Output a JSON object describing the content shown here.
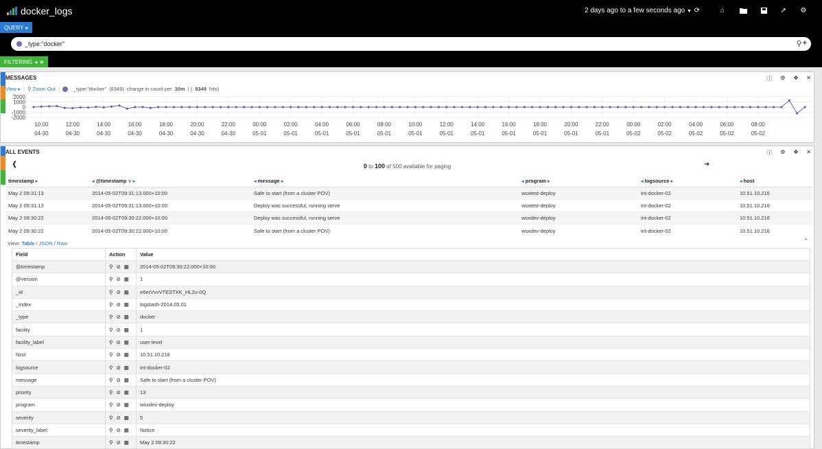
{
  "header": {
    "title": "docker_logs",
    "time_range": "2 days ago to a few seconds ago",
    "logo_colors": [
      "#f9a825",
      "#2a7ad7",
      "#3fb53a",
      "#2a7ad7"
    ]
  },
  "query": {
    "tab_label": "QUERY",
    "value": "_type:\"docker\"",
    "color": "#7a6bb5"
  },
  "filtering": {
    "tab_label": "FILTERING"
  },
  "messages_panel": {
    "title": "MESSAGES",
    "view_label": "View",
    "zoom_label": "Zoom Out",
    "legend_query": "_type:\"docker\"",
    "legend_count": "(8349)",
    "change_text": "change in count per",
    "interval": "30m",
    "hits_prefix": "| (",
    "hits": "8349",
    "hits_suffix": "hits)"
  },
  "chart_data": {
    "type": "line",
    "title": "",
    "xlabel": "",
    "ylabel": "",
    "yticks": [
      "2000",
      "1000",
      "0",
      "-1000",
      "-2000"
    ],
    "ylim": [
      -2000,
      2000
    ],
    "xticks": [
      [
        "10:00",
        "04-30"
      ],
      [
        "12:00",
        "04-30"
      ],
      [
        "14:00",
        "04-30"
      ],
      [
        "16:00",
        "04-30"
      ],
      [
        "18:00",
        "04-30"
      ],
      [
        "20:00",
        "04-30"
      ],
      [
        "22:00",
        "04-30"
      ],
      [
        "00:00",
        "05-01"
      ],
      [
        "02:00",
        "05-01"
      ],
      [
        "04:00",
        "05-01"
      ],
      [
        "06:00",
        "05-01"
      ],
      [
        "08:00",
        "05-01"
      ],
      [
        "10:00",
        "05-01"
      ],
      [
        "12:00",
        "05-01"
      ],
      [
        "14:00",
        "05-01"
      ],
      [
        "16:00",
        "05-01"
      ],
      [
        "18:00",
        "05-01"
      ],
      [
        "20:00",
        "05-01"
      ],
      [
        "22:00",
        "05-01"
      ],
      [
        "00:00",
        "05-02"
      ],
      [
        "02:00",
        "05-02"
      ],
      [
        "04:00",
        "05-02"
      ],
      [
        "06:00",
        "05-02"
      ],
      [
        "08:00",
        "05-02"
      ]
    ],
    "x_start_label": "2014-04-30 09:30",
    "interval_minutes": 30,
    "series": [
      {
        "values": [
          0,
          100,
          150,
          200,
          -150,
          -200,
          -50,
          -100,
          50,
          -50,
          100,
          300,
          -300,
          0,
          20,
          -150,
          0,
          0,
          0,
          0,
          0,
          0,
          0,
          0,
          0,
          0,
          0,
          0,
          0,
          0,
          0,
          0,
          0,
          0,
          0,
          0,
          0,
          0,
          0,
          0,
          0,
          0,
          0,
          0,
          0,
          0,
          0,
          0,
          0,
          0,
          0,
          0,
          0,
          0,
          0,
          0,
          0,
          0,
          0,
          0,
          0,
          0,
          0,
          0,
          0,
          0,
          0,
          0,
          0,
          0,
          0,
          0,
          0,
          0,
          0,
          0,
          0,
          0,
          0,
          0,
          0,
          0,
          0,
          0,
          0,
          0,
          0,
          0,
          0,
          0,
          0,
          0,
          0,
          0,
          0,
          0,
          0,
          1300,
          -1200,
          0
        ],
        "color": "#6a5fb0"
      }
    ],
    "grid": true
  },
  "events_panel": {
    "title": "ALL EVENTS",
    "paging_from": "0",
    "paging_to_word": "to",
    "paging_to": "100",
    "paging_rest": "of 500 available for paging",
    "columns": [
      "timestamp",
      "@timestamp",
      "message",
      "program",
      "logsource",
      "host"
    ],
    "rows": [
      [
        "May  2 09:31:13",
        "2014-05-02T09:31:13.000+10:00",
        "Safe to start (from a cluster POV)",
        "wsxtest-deploy",
        "int-docker-02",
        "10.51.10.216"
      ],
      [
        "May  2 09:31:13",
        "2014-05-02T09:31:13.000+10:00",
        "Deploy was successful, running serve",
        "wsxtest-deploy",
        "int-docker-02",
        "10.51.10.216"
      ],
      [
        "May  2 09:30:22",
        "2014-05-02T09:30:22.000+10:00",
        "Deploy was successful, running serve",
        "wsxdev-deploy",
        "int-docker-02",
        "10.51.10.216"
      ],
      [
        "May  2 09:30:22",
        "2014-05-02T09:30:22.000+10:00",
        "Safe to start (from a cluster POV)",
        "wsxdev-deploy",
        "int-docker-02",
        "10.51.10.216"
      ]
    ],
    "view_prefix": "View:",
    "view_table": "Table",
    "view_json": "JSON",
    "view_raw": "Raw",
    "field_headers": [
      "Field",
      "Action",
      "Value"
    ],
    "fields": [
      [
        "@timestamp",
        "2014-05-02T09:30:22.000+10:00"
      ],
      [
        "@version",
        "1"
      ],
      [
        "_id",
        "e6erVvvVTESTXK_HL2u-0Q"
      ],
      [
        "_index",
        "logstash-2014.05.01"
      ],
      [
        "_type",
        "docker"
      ],
      [
        "facility",
        "1"
      ],
      [
        "facility_label",
        "user-level"
      ],
      [
        "host",
        "10.51.10.216"
      ],
      [
        "logsource",
        "int-docker-02"
      ],
      [
        "message",
        "Safe to start (from a cluster POV)"
      ],
      [
        "priority",
        "13"
      ],
      [
        "program",
        "wsxdev-deploy"
      ],
      [
        "severity",
        "5"
      ],
      [
        "severity_label",
        "Notice"
      ],
      [
        "timestamp",
        "May  2 09:30:22"
      ]
    ]
  },
  "strip_colors": [
    "#2a7ad7",
    "#f28a1a",
    "#3fb53a"
  ]
}
